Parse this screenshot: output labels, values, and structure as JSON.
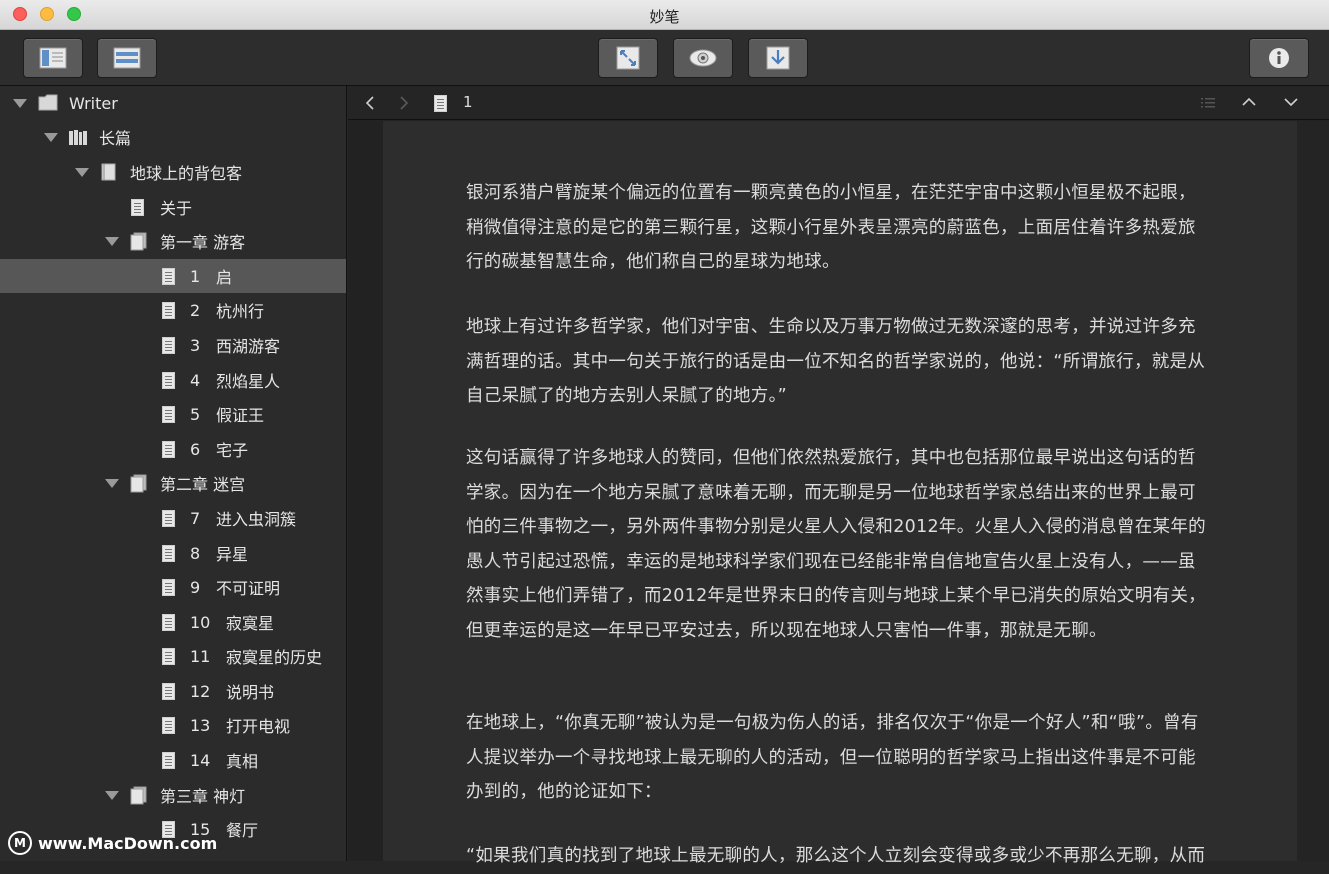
{
  "window": {
    "title": "妙笔"
  },
  "toolbar": {
    "left_buttons": [
      "sidebar-toggle-icon",
      "layout-icon"
    ],
    "center_buttons": [
      "fullscreen-icon",
      "preview-eye-icon",
      "export-download-icon"
    ],
    "right_buttons": [
      "info-icon"
    ]
  },
  "sidebar": {
    "root": "Writer",
    "group": "长篇",
    "book": "地球上的背包客",
    "about": "关于",
    "chapters": [
      {
        "title": "第一章 游客"
      },
      {
        "title": "第二章 迷宫"
      },
      {
        "title": "第三章 神灯"
      }
    ],
    "items": [
      {
        "num": "1",
        "title": "启"
      },
      {
        "num": "2",
        "title": "杭州行"
      },
      {
        "num": "3",
        "title": "西湖游客"
      },
      {
        "num": "4",
        "title": "烈焰星人"
      },
      {
        "num": "5",
        "title": "假证王"
      },
      {
        "num": "6",
        "title": "宅子"
      },
      {
        "num": "7",
        "title": "进入虫洞簇"
      },
      {
        "num": "8",
        "title": "异星"
      },
      {
        "num": "9",
        "title": "不可证明"
      },
      {
        "num": "10",
        "title": "寂寞星"
      },
      {
        "num": "11",
        "title": "寂寞星的历史"
      },
      {
        "num": "12",
        "title": "说明书"
      },
      {
        "num": "13",
        "title": "打开电视"
      },
      {
        "num": "14",
        "title": "真相"
      },
      {
        "num": "15",
        "title": "餐厅"
      }
    ]
  },
  "navbar": {
    "doc_title": "1"
  },
  "editor": {
    "paragraphs": [
      "银河系猎户臂旋某个偏远的位置有一颗亮黄色的小恒星，在茫茫宇宙中这颗小恒星极不起眼，稍微值得注意的是它的第三颗行星，这颗小行星外表呈漂亮的蔚蓝色，上面居住着许多热爱旅行的碳基智慧生命，他们称自己的星球为地球。",
      "地球上有过许多哲学家，他们对宇宙、生命以及万事万物做过无数深邃的思考，并说过许多充满哲理的话。其中一句关于旅行的话是由一位不知名的哲学家说的，他说：“所谓旅行，就是从自己呆腻了的地方去别人呆腻了的地方。”",
      "这句话赢得了许多地球人的赞同，但他们依然热爱旅行，其中也包括那位最早说出这句话的哲学家。因为在一个地方呆腻了意味着无聊，而无聊是另一位地球哲学家总结出来的世界上最可怕的三件事物之一，另外两件事物分别是火星人入侵和2012年。火星人入侵的消息曾在某年的愚人节引起过恐慌，幸运的是地球科学家们现在已经能非常自信地宣告火星上没有人，——虽然事实上他们弄错了，而2012年是世界末日的传言则与地球上某个早已消失的原始文明有关，但更幸运的是这一年早已平安过去，所以现在地球人只害怕一件事，那就是无聊。",
      "在地球上，“你真无聊”被认为是一句极为伤人的话，排名仅次于“你是一个好人”和“哦”。曾有人提议举办一个寻找地球上最无聊的人的活动，但一位聪明的哲学家马上指出这件事是不可能办到的，他的论证如下：",
      "“如果我们真的找到了地球上最无聊的人，那么这个人立刻会变得或多或少不再那么无聊，从而"
    ]
  },
  "watermark": {
    "text": "www.MacDown.com",
    "logo": "M"
  }
}
